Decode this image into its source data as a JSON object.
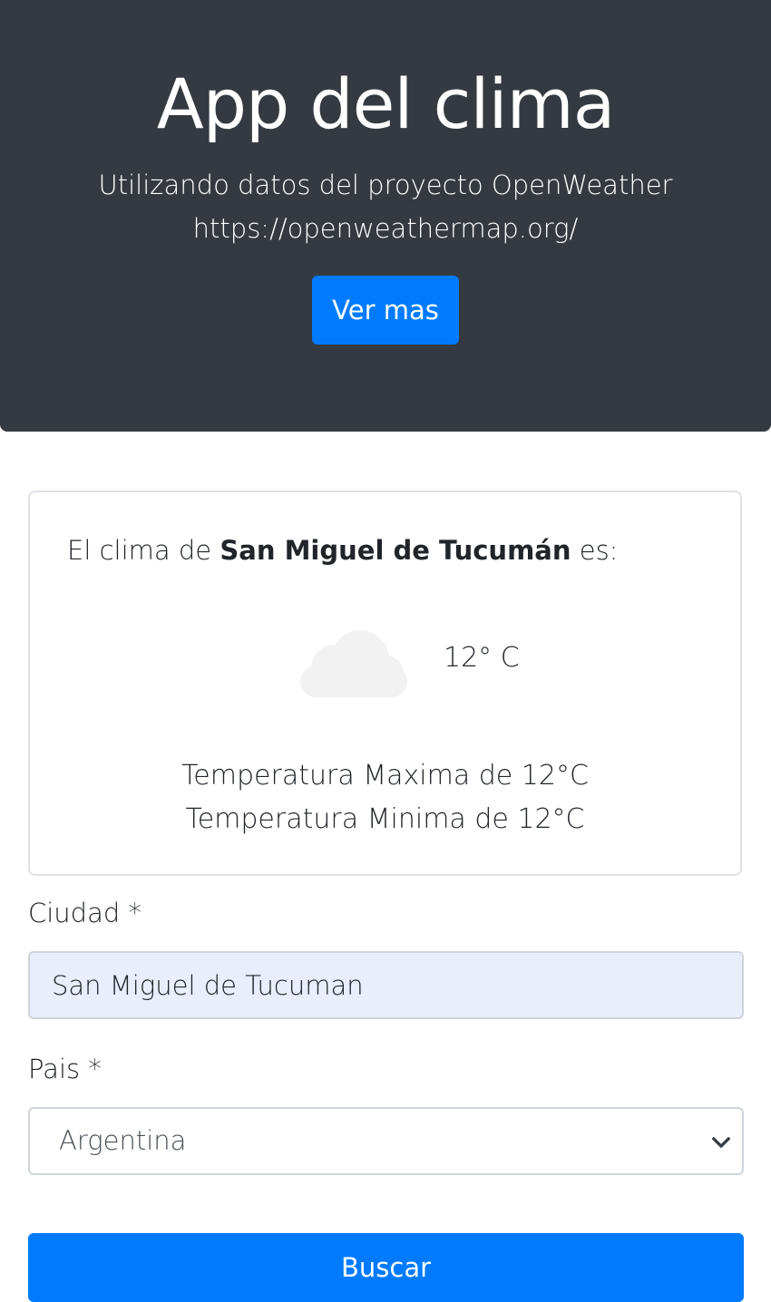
{
  "hero": {
    "title": "App del clima",
    "subtitle_line1": "Utilizando datos del proyecto OpenWeather",
    "subtitle_line2": "https://openweathermap.org/",
    "button_label": "Ver mas"
  },
  "weather": {
    "prefix": "El clima de ",
    "city": "San Miguel de Tucumán",
    "suffix": " es:",
    "icon": "cloud-icon",
    "current_temp": "12° C",
    "max_temp": "Temperatura Maxima de 12°C",
    "min_temp": "Temperatura Minima de 12°C"
  },
  "form": {
    "city_label": "Ciudad *",
    "city_value": "San Miguel de Tucuman",
    "country_label": "Pais *",
    "country_value": "Argentina",
    "submit_label": "Buscar"
  },
  "colors": {
    "hero_bg": "#343a40",
    "primary": "#007bff",
    "input_autofill_bg": "#e8eefc",
    "cloud": "#f2f2f2"
  }
}
